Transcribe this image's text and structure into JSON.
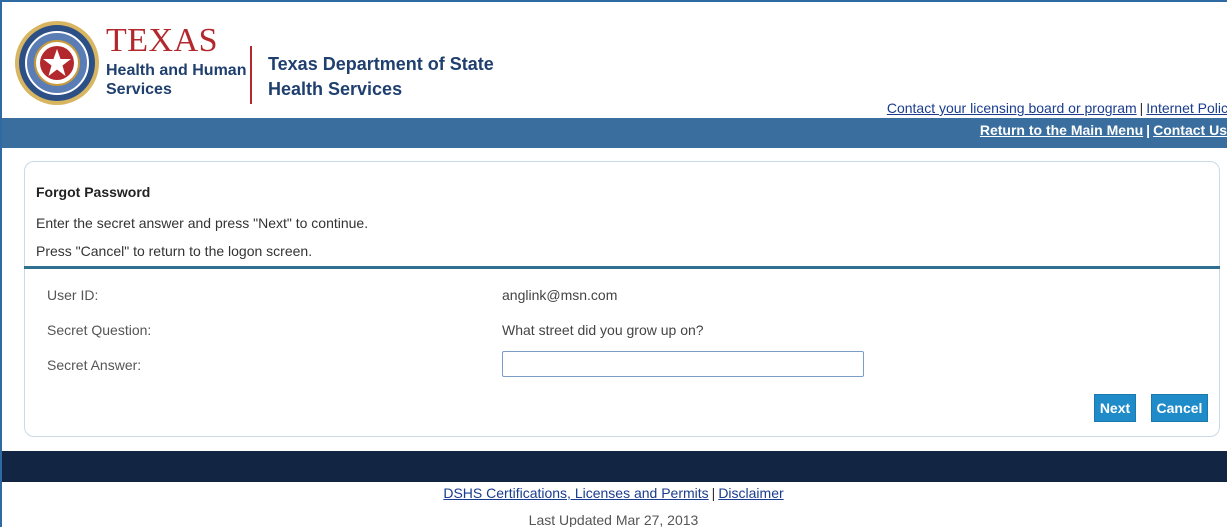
{
  "header": {
    "logo_texas": "TEXAS",
    "logo_hhs_line1": "Health and Human",
    "logo_hhs_line2": "Services",
    "logo_dshs_line1": "Texas Department of State",
    "logo_dshs_line2": "Health Services",
    "top_links": {
      "licensing": "Contact your licensing board or program",
      "internet_policy": "Internet Policy"
    }
  },
  "navbar": {
    "main_menu": "Return to the Main Menu",
    "contact_us": "Contact Us"
  },
  "form": {
    "title": "Forgot Password",
    "instruction1": "Enter the secret answer and press \"Next\" to continue.",
    "instruction2": "Press \"Cancel\" to return to the logon screen.",
    "user_id_label": "User ID:",
    "user_id_value": "anglink@msn.com",
    "question_label": "Secret Question:",
    "question_value": "What street did you grow up on?",
    "answer_label": "Secret Answer:",
    "answer_value": "",
    "next_label": "Next",
    "cancel_label": "Cancel"
  },
  "footer": {
    "certifications": "DSHS Certifications, Licenses and Permits",
    "disclaimer": "Disclaimer",
    "last_updated": "Last Updated Mar 27, 2013"
  },
  "icons": {
    "seal": "texas-state-seal-icon"
  },
  "colors": {
    "navbar": "#3a6e9f",
    "footer_bar": "#122543",
    "button": "#1f8bc9",
    "brand_red": "#b3282d",
    "brand_navy": "#1f3f6e",
    "link": "#1a3c8f"
  }
}
